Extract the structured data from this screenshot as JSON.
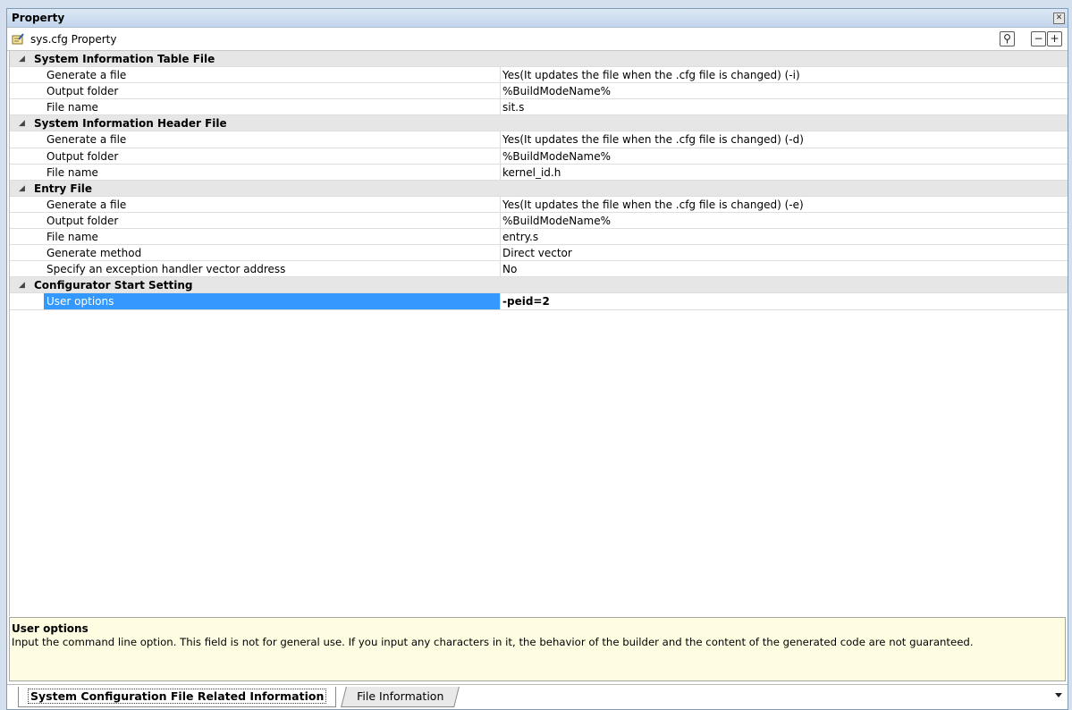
{
  "window": {
    "title": "Property"
  },
  "toolbar": {
    "caption": "sys.cfg Property",
    "icon": "property-sheet-icon"
  },
  "grid": {
    "sections": [
      {
        "label": "System Information Table File",
        "rows": [
          {
            "name": "Generate a file",
            "value": "Yes(It updates the file when the .cfg file is changed) (-i)"
          },
          {
            "name": "Output folder",
            "value": "%BuildModeName%"
          },
          {
            "name": "File name",
            "value": "sit.s"
          }
        ]
      },
      {
        "label": "System Information Header File",
        "rows": [
          {
            "name": "Generate a file",
            "value": "Yes(It updates the file when the .cfg file is changed) (-d)"
          },
          {
            "name": "Output folder",
            "value": "%BuildModeName%"
          },
          {
            "name": "File name",
            "value": "kernel_id.h"
          }
        ]
      },
      {
        "label": "Entry File",
        "rows": [
          {
            "name": "Generate a file",
            "value": "Yes(It updates the file when the .cfg file is changed) (-e)"
          },
          {
            "name": "Output folder",
            "value": "%BuildModeName%"
          },
          {
            "name": "File name",
            "value": "entry.s"
          },
          {
            "name": "Generate method",
            "value": "Direct vector"
          },
          {
            "name": "Specify an exception handler vector address",
            "value": "No"
          }
        ]
      },
      {
        "label": "Configurator Start Setting",
        "rows": [
          {
            "name": "User options",
            "value": "-peid=2",
            "selected": true
          }
        ]
      }
    ]
  },
  "description": {
    "title": "User options",
    "text": "Input the command line option. This field is not for general use. If you input any characters in it, the behavior of the builder and the content of the generated code are not guaranteed."
  },
  "tabs": [
    {
      "label": "System Configuration File Related Information",
      "active": true
    },
    {
      "label": "File Information",
      "active": false
    }
  ],
  "colors": {
    "selection": "#3399ff",
    "description_bg": "#fffde1",
    "category_bg": "#e6e6e6"
  }
}
